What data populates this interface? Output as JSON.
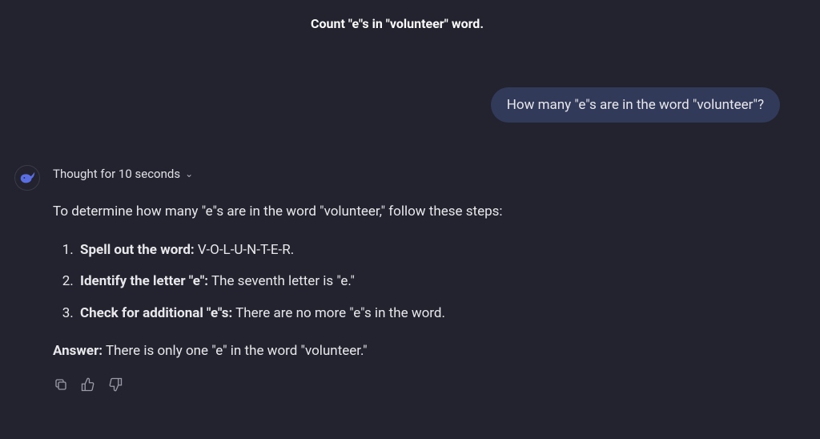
{
  "title": "Count \"e\"s in \"volunteer\" word.",
  "user_message": "How many \"e\"s are in the word \"volunteer\"?",
  "thought_label": "Thought for 10 seconds",
  "response": {
    "intro": "To determine how many \"e\"s are in the word \"volunteer,\" follow these steps:",
    "steps": [
      {
        "bold": "Spell out the word:",
        "rest": " V-O-L-U-N-T-E-R."
      },
      {
        "bold": "Identify the letter \"e\":",
        "rest": " The seventh letter is \"e.\""
      },
      {
        "bold": "Check for additional \"e\"s:",
        "rest": " There are no more \"e\"s in the word."
      }
    ],
    "answer_label": "Answer:",
    "answer_text": " There is only one \"e\" in the word \"volunteer.\""
  }
}
